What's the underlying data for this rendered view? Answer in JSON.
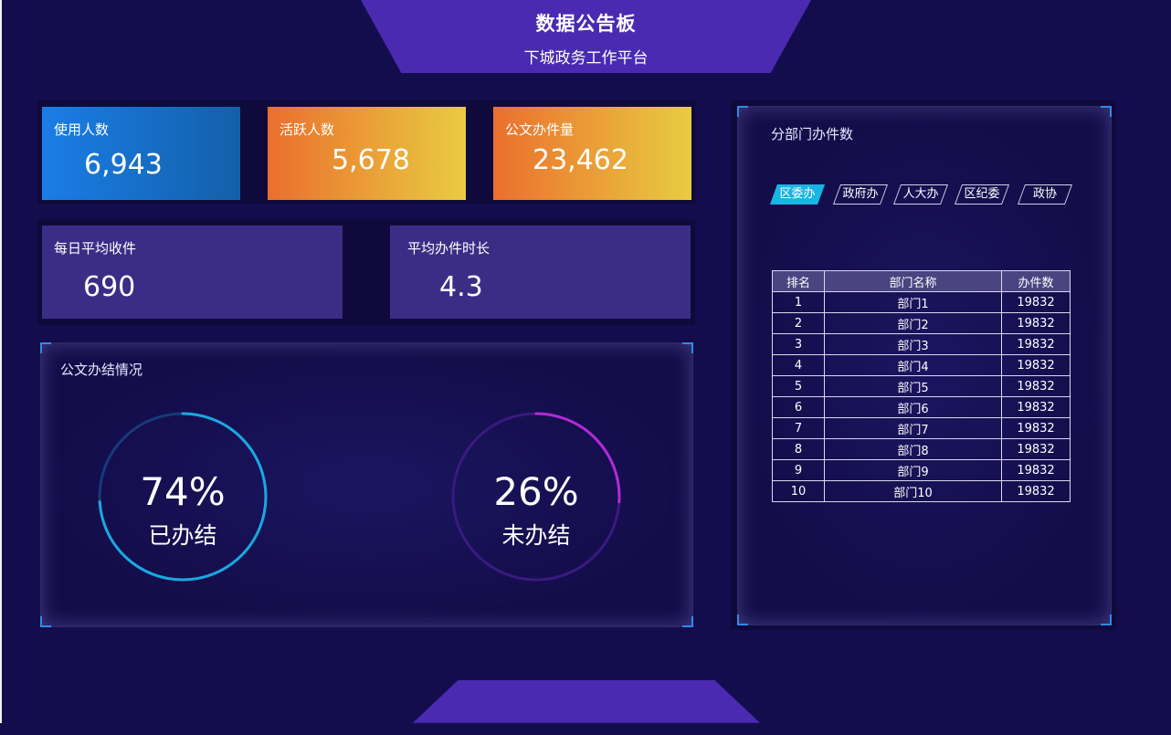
{
  "header": {
    "title": "数据公告板",
    "subtitle": "下城政务工作平台"
  },
  "stats_top": [
    {
      "label": "使用人数",
      "value": "6,943"
    },
    {
      "label": "活跃人数",
      "value": "5,678"
    },
    {
      "label": "公文办件量",
      "value": "23,462"
    }
  ],
  "stats_mid": [
    {
      "label": "每日平均收件",
      "value": "690"
    },
    {
      "label": "平均办件时长",
      "value": "4.3"
    }
  ],
  "completion": {
    "title": "公文办结情况",
    "done": {
      "percent": 74,
      "percent_text": "74%",
      "label": "已办结",
      "color": "#1aa8e0"
    },
    "pending": {
      "percent": 26,
      "percent_text": "26%",
      "label": "未办结",
      "color": "#b12bd6"
    }
  },
  "dept": {
    "title": "分部门办件数",
    "tabs": [
      "区委办",
      "政府办",
      "人大办",
      "区纪委",
      "政协"
    ],
    "active_tab": "区委办",
    "columns": [
      "排名",
      "部门名称",
      "办件数"
    ],
    "rows": [
      [
        "1",
        "部门1",
        "19832"
      ],
      [
        "2",
        "部门2",
        "19832"
      ],
      [
        "3",
        "部门3",
        "19832"
      ],
      [
        "4",
        "部门4",
        "19832"
      ],
      [
        "5",
        "部门5",
        "19832"
      ],
      [
        "6",
        "部门6",
        "19832"
      ],
      [
        "7",
        "部门7",
        "19832"
      ],
      [
        "8",
        "部门8",
        "19832"
      ],
      [
        "9",
        "部门9",
        "19832"
      ],
      [
        "10",
        "部门10",
        "19832"
      ]
    ]
  },
  "colors": {
    "background": "#140d4d",
    "banner": "#4a2ab0",
    "accent_blue": "#18b6e2"
  }
}
